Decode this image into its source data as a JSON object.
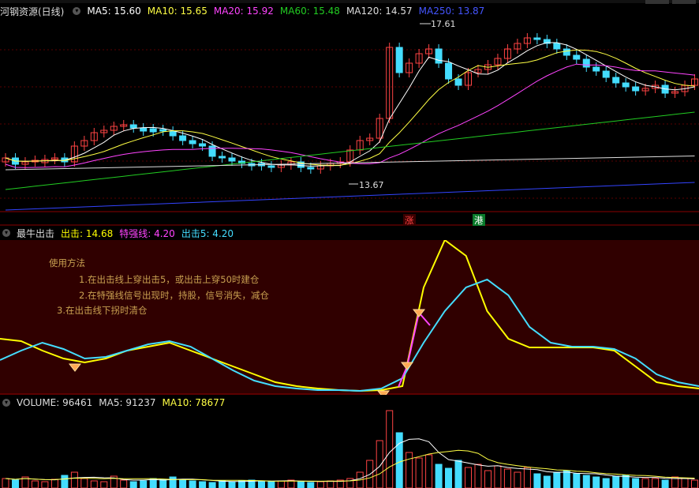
{
  "main": {
    "stock_name": "河钢资源(日线)",
    "ma": [
      {
        "label": "MA5",
        "value": "15.60",
        "color": "#ffffff"
      },
      {
        "label": "MA10",
        "value": "15.65",
        "color": "#ffff44"
      },
      {
        "label": "MA20",
        "value": "15.92",
        "color": "#ff44ff"
      },
      {
        "label": "MA60",
        "value": "15.48",
        "color": "#22cc22"
      },
      {
        "label": "MA120",
        "value": "14.57",
        "color": "#dddddd"
      },
      {
        "label": "MA250",
        "value": "13.87",
        "color": "#4455ff"
      }
    ],
    "high_label": "17.61",
    "low_label": "13.67",
    "badge_zhang": "涨",
    "badge_gang": "港"
  },
  "indicator": {
    "name": "最牛出击",
    "items": [
      {
        "label": "出击:",
        "value": "14.68",
        "color": "#ffff00"
      },
      {
        "label": "特强线:",
        "value": "4.20",
        "color": "#ff44ff"
      },
      {
        "label": "出击5:",
        "value": "4.20",
        "color": "#44ddff"
      }
    ],
    "notes": [
      "使用方法",
      "1.在出击线上穿出击5，或出击上穿50时建仓",
      "2.在特强线信号出现时，持股，信号消失，减仓",
      "3.在出击线下拐时清仓"
    ]
  },
  "volume": {
    "items": [
      {
        "label": "VOLUME:",
        "value": "96461",
        "color": "#dddddd"
      },
      {
        "label": "MA5:",
        "value": "91237",
        "color": "#dddddd"
      },
      {
        "label": "MA10:",
        "value": "78677",
        "color": "#ffff44"
      }
    ]
  }
}
